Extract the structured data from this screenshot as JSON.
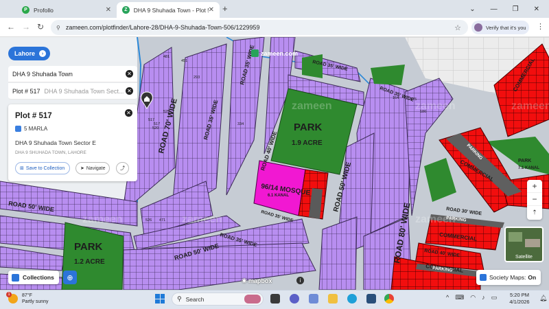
{
  "browser": {
    "tabs": [
      {
        "title": "Profollo",
        "favicon": "P",
        "active": false
      },
      {
        "title": "DHA 9 Shuhada Town - Plot 51",
        "favicon": "Z",
        "active": true
      }
    ],
    "new_tab": "+",
    "url": "zameen.com/plotfinder/Lahore-28/DHA-9-Shuhada-Town-506/1229959",
    "verify_label": "Verify that it's you"
  },
  "map": {
    "city_label": "Lahore",
    "search_society": "DHA 9 Shuhada Town",
    "search_plot_label": "Plot # 517",
    "search_plot_context": "DHA 9 Shuhada Town Sect...",
    "logo_text": "zameen.com",
    "road_labels": [
      "ROAD 70' WIDE",
      "ROAD 35' WIDE",
      "ROAD 35' WIDE",
      "ROAD 40' WIDE",
      "ROAD 50' WIDE",
      "ROAD 80' WIDE",
      "ROAD 35' WIDE",
      "ROAD 35' WIDE",
      "ROAD 50' WIDE",
      "ROAD 50' WIDE",
      "ROAD 35' WIDE",
      "ROAD 30' WIDE",
      "ROAD 40' WIDE",
      "ROAD 35' WIDE"
    ],
    "areas": [
      {
        "name": "PARK",
        "sub": "1.9 ACRE"
      },
      {
        "name": "PARK",
        "sub": "1.2 ACRE"
      },
      {
        "name": "96/14 MOSQUE",
        "sub": "6.1 KANAL"
      },
      {
        "name": "COMMERCIAL"
      },
      {
        "name": "COMMERCIAL"
      },
      {
        "name": "COMMERCIAL"
      },
      {
        "name": "COMMERCIAL"
      },
      {
        "name": "PARKING"
      },
      {
        "name": "PARKING"
      },
      {
        "name": "PARKING"
      },
      {
        "name": "PARK",
        "sub": "7.1 KANAL"
      }
    ],
    "plot_numbers": [
      "481",
      "517",
      "520",
      "525",
      "334",
      "293",
      "164",
      "175",
      "186",
      "517",
      "451",
      "471",
      "526"
    ]
  },
  "plot_card": {
    "title": "Plot # 517",
    "size": "5 MARLA",
    "sector": "DHA 9 Shuhada Town Sector E",
    "location": "DHA 9 SHUHADA TOWN, LAHORE",
    "save_label": "Save to Collection",
    "navigate_label": "Navigate"
  },
  "controls": {
    "zoom_in": "+",
    "zoom_out": "−",
    "compass": "⇡",
    "satellite_label": "Satellite",
    "collections_label": "Collections",
    "mapbox_label": "mapbox",
    "society_maps_label": "Society Maps:",
    "society_maps_state": "On"
  },
  "taskbar": {
    "weather_temp": "87°F",
    "weather_desc": "Partly sunny",
    "weather_badge": "1",
    "search_placeholder": "Search",
    "time": "5:20 PM",
    "date": "4/1/2026"
  },
  "colors": {
    "plot_purple": "#b88ef0",
    "park_green": "#2f8a2f",
    "commercial_red": "#f20e0e",
    "mosque_magenta": "#f118d2",
    "road_gray": "#c6ccd4",
    "accent_blue": "#2b74d9"
  }
}
